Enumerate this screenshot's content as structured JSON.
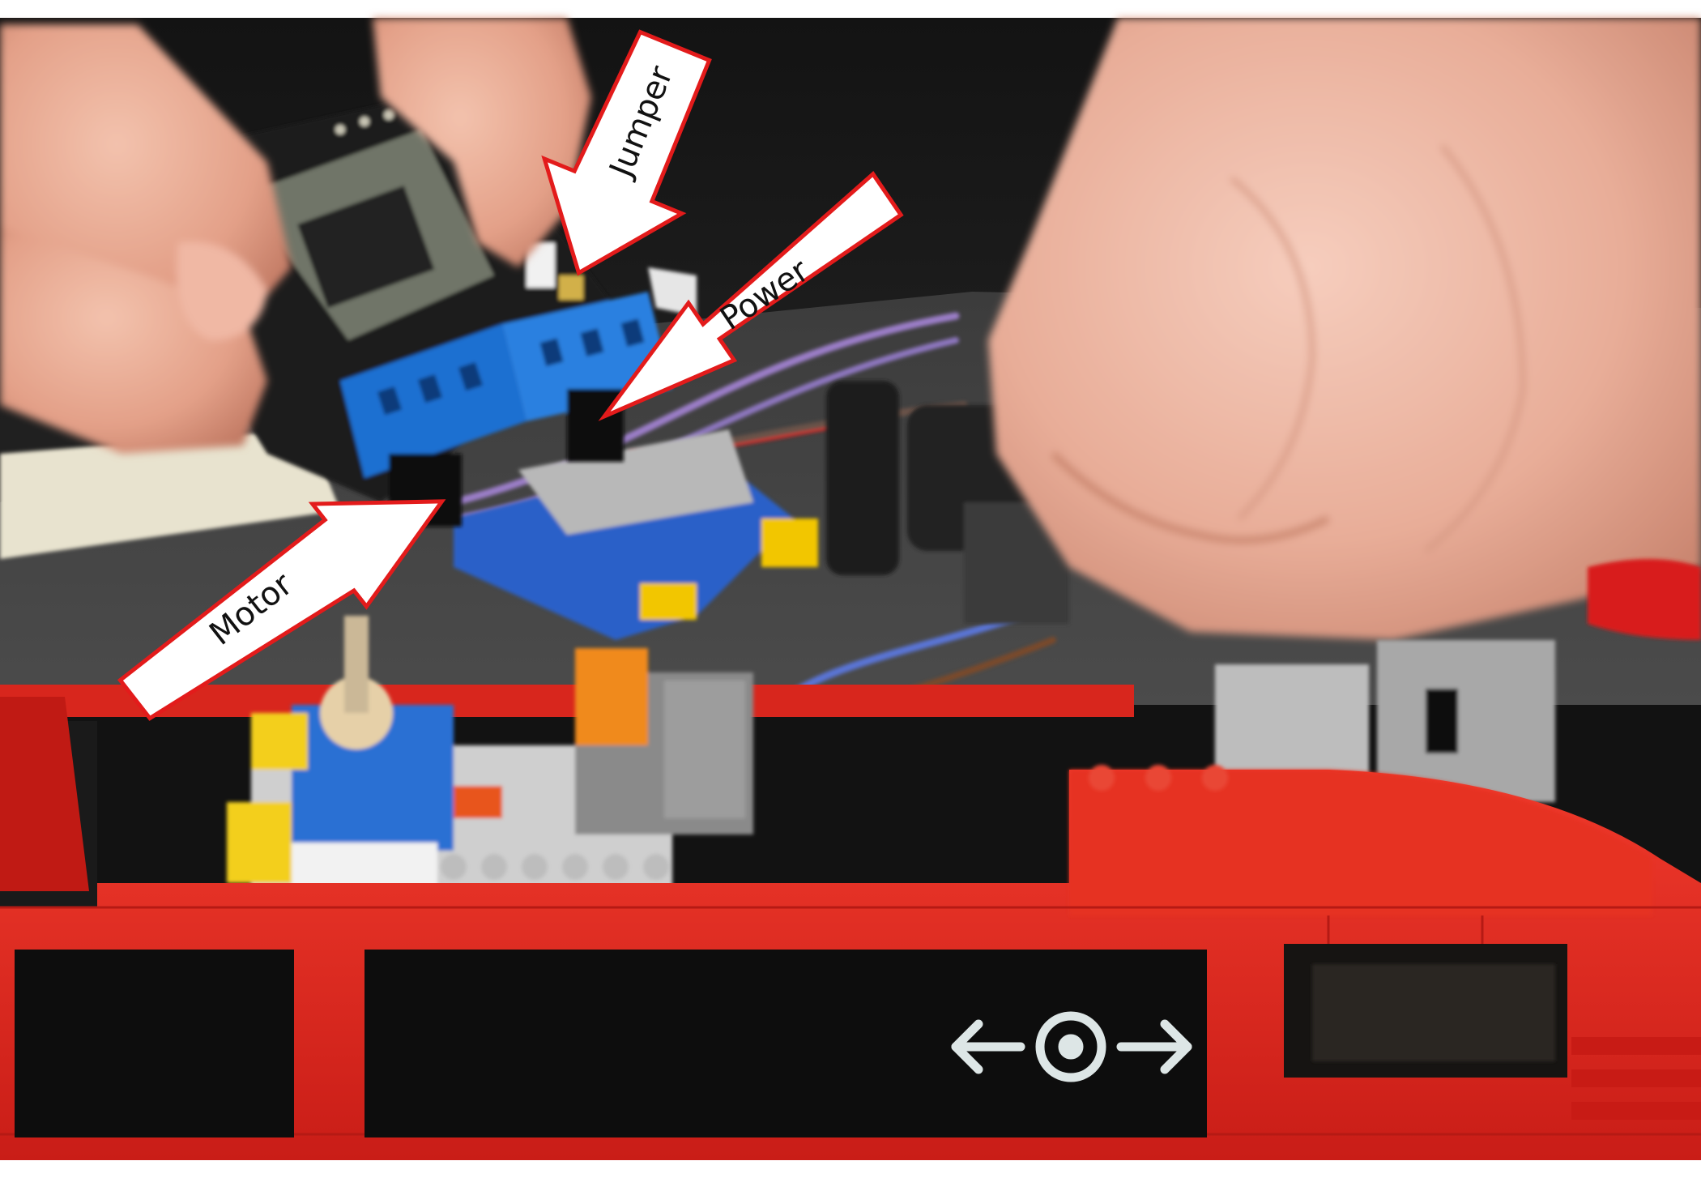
{
  "image": {
    "description": "Close-up photo of hands holding a small microcontroller board above a red LEGO train, with three callout arrows labelling connectors"
  },
  "callouts": [
    {
      "id": "jumper",
      "label": "Jumper"
    },
    {
      "id": "power",
      "label": "Power"
    },
    {
      "id": "motor",
      "label": "Motor"
    }
  ],
  "colors": {
    "arrow_fill": "#ffffff",
    "arrow_outline": "#e31b1b",
    "train_red": "#e0241c",
    "terminal_blue": "#1f6fd1",
    "background_dark": "#2a2a2a",
    "skin": "#e8a891",
    "window_black": "#0d0d0d",
    "sign_white": "#dde6e6"
  },
  "icons": {
    "rail_sign": "railway-station-symbol-icon"
  }
}
